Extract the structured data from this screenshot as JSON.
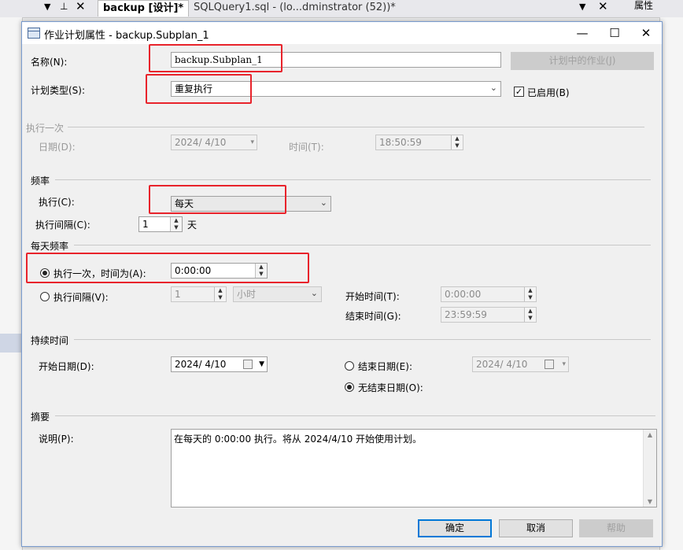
{
  "ide": {
    "tab1": "backup [设计]*",
    "tab2": "SQLQuery1.sql - (lo...dminstrator (52))*",
    "right_panel": "属性"
  },
  "dialog": {
    "title": "作业计划属性 - backup.Subplan_1",
    "name_label": "名称(N):",
    "name_value": "backup.Subplan_1",
    "jobs_in_schedule_button": "计划中的作业(J)",
    "schedule_type_label": "计划类型(S):",
    "schedule_type_value": "重复执行",
    "enabled_label": "已启用(B)",
    "one_time": {
      "section": "执行一次",
      "date_label": "日期(D):",
      "date_value": "2024/ 4/10",
      "time_label": "时间(T):",
      "time_value": "18:50:59"
    },
    "frequency": {
      "section": "频率",
      "occurs_label": "执行(C):",
      "occurs_value": "每天",
      "recurs_label": "执行间隔(C):",
      "recurs_value": "1",
      "recurs_unit": "天"
    },
    "daily": {
      "section": "每天频率",
      "once_label": "执行一次，时间为(A):",
      "once_value": "0:00:00",
      "every_label": "执行间隔(V):",
      "every_value": "1",
      "every_unit": "小时",
      "start_time_label": "开始时间(T):",
      "start_time_value": "0:00:00",
      "end_time_label": "结束时间(G):",
      "end_time_value": "23:59:59"
    },
    "duration": {
      "section": "持续时间",
      "start_date_label": "开始日期(D):",
      "start_date_value": "2024/ 4/10",
      "end_date_label": "结束日期(E):",
      "end_date_value": "2024/ 4/10",
      "no_end_date_label": "无结束日期(O):"
    },
    "summary": {
      "section": "摘要",
      "description_label": "说明(P):",
      "description_value": "在每天的 0:00:00 执行。将从 2024/4/10 开始使用计划。"
    },
    "ok_button": "确定",
    "cancel_button": "取消",
    "help_button": "帮助"
  },
  "colors": {
    "accent": "#0078d7",
    "highlight_box": "#e8232b"
  }
}
